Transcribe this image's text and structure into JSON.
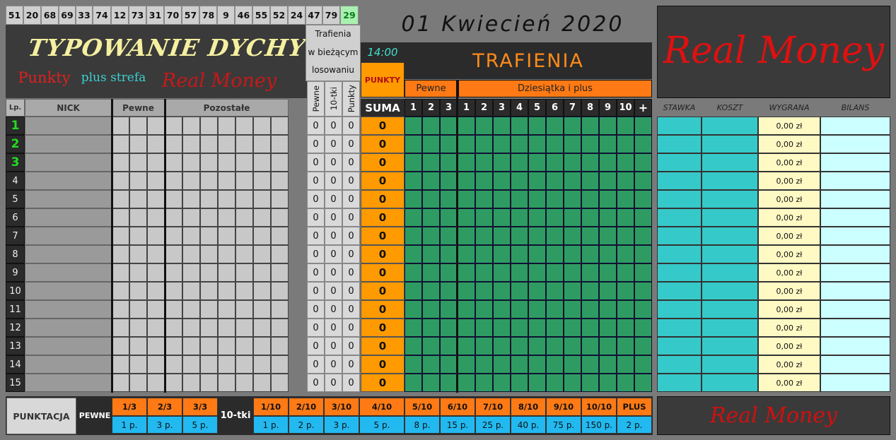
{
  "numbers": [
    "51",
    "20",
    "68",
    "69",
    "33",
    "74",
    "12",
    "73",
    "31",
    "70",
    "57",
    "78",
    "9",
    "46",
    "55",
    "52",
    "24",
    "47",
    "79",
    "29"
  ],
  "highlight_number_index": 19,
  "logo": {
    "title": "TYPOWANIE DYCHY",
    "punkty": "Punkty",
    "plus_strefa": "plus strefa",
    "real_money": "Real Money"
  },
  "trafienia_label": {
    "line1": "Trafienia",
    "line2": "w bieżącym",
    "line3": "losowaniu"
  },
  "clock": "14:00",
  "punkty_label": "PUNKTY",
  "trafienia_title": "TRAFIENIA",
  "date": "01  Kwiecień  2020",
  "big_brand": "Real Money",
  "groups": {
    "pewne": "Pewne",
    "dziesiatka": "Dziesiątka i plus"
  },
  "columns": {
    "lp": "Lp.",
    "nick": "NICK",
    "pewne": "Pewne",
    "pozostale": "Pozostałe",
    "pewne_v": "Pewne",
    "tki_v": "10-tki",
    "punkty_v": "Punkty",
    "suma": "SUMA",
    "stawka": "STAWKA",
    "koszt": "KOSZT",
    "wygrana": "WYGRANA",
    "bilans": "BILANS"
  },
  "hit_columns": [
    "1",
    "2",
    "3",
    "1",
    "2",
    "3",
    "4",
    "5",
    "6",
    "7",
    "8",
    "9",
    "10",
    "+"
  ],
  "rows": [
    {
      "lp": "1",
      "p": "0",
      "t": "0",
      "pk": "0",
      "suma": "0",
      "wygrana": "0,00 zł"
    },
    {
      "lp": "2",
      "p": "0",
      "t": "0",
      "pk": "0",
      "suma": "0",
      "wygrana": "0,00 zł"
    },
    {
      "lp": "3",
      "p": "0",
      "t": "0",
      "pk": "0",
      "suma": "0",
      "wygrana": "0,00 zł"
    },
    {
      "lp": "4",
      "p": "0",
      "t": "0",
      "pk": "0",
      "suma": "0",
      "wygrana": "0,00 zł"
    },
    {
      "lp": "5",
      "p": "0",
      "t": "0",
      "pk": "0",
      "suma": "0",
      "wygrana": "0,00 zł"
    },
    {
      "lp": "6",
      "p": "0",
      "t": "0",
      "pk": "0",
      "suma": "0",
      "wygrana": "0,00 zł"
    },
    {
      "lp": "7",
      "p": "0",
      "t": "0",
      "pk": "0",
      "suma": "0",
      "wygrana": "0,00 zł"
    },
    {
      "lp": "8",
      "p": "0",
      "t": "0",
      "pk": "0",
      "suma": "0",
      "wygrana": "0,00 zł"
    },
    {
      "lp": "9",
      "p": "0",
      "t": "0",
      "pk": "0",
      "suma": "0",
      "wygrana": "0,00 zł"
    },
    {
      "lp": "10",
      "p": "0",
      "t": "0",
      "pk": "0",
      "suma": "0",
      "wygrana": "0,00 zł"
    },
    {
      "lp": "11",
      "p": "0",
      "t": "0",
      "pk": "0",
      "suma": "0",
      "wygrana": "0,00 zł"
    },
    {
      "lp": "12",
      "p": "0",
      "t": "0",
      "pk": "0",
      "suma": "0",
      "wygrana": "0,00 zł"
    },
    {
      "lp": "13",
      "p": "0",
      "t": "0",
      "pk": "0",
      "suma": "0",
      "wygrana": "0,00 zł"
    },
    {
      "lp": "14",
      "p": "0",
      "t": "0",
      "pk": "0",
      "suma": "0",
      "wygrana": "0,00 zł"
    },
    {
      "lp": "15",
      "p": "0",
      "t": "0",
      "pk": "0",
      "suma": "0",
      "wygrana": "0,00 zł"
    }
  ],
  "scoring": {
    "label": "PUNKTACJA",
    "pewne_label": "PEWNE",
    "pewne": [
      {
        "k": "1/3",
        "v": "1 p."
      },
      {
        "k": "2/3",
        "v": "3 p."
      },
      {
        "k": "3/3",
        "v": "5 p."
      }
    ],
    "tki_label": "10-tki",
    "tki": [
      {
        "k": "1/10",
        "v": "1 p."
      },
      {
        "k": "2/10",
        "v": "2 p."
      },
      {
        "k": "3/10",
        "v": "3 p."
      },
      {
        "k": "4/10",
        "v": "5 p."
      },
      {
        "k": "5/10",
        "v": "8 p."
      },
      {
        "k": "6/10",
        "v": "15 p."
      },
      {
        "k": "7/10",
        "v": "25 p."
      },
      {
        "k": "8/10",
        "v": "40 p."
      },
      {
        "k": "9/10",
        "v": "75 p."
      },
      {
        "k": "10/10",
        "v": "150 p."
      },
      {
        "k": "PLUS",
        "v": "2 p."
      }
    ]
  },
  "footer_brand": "Real Money"
}
